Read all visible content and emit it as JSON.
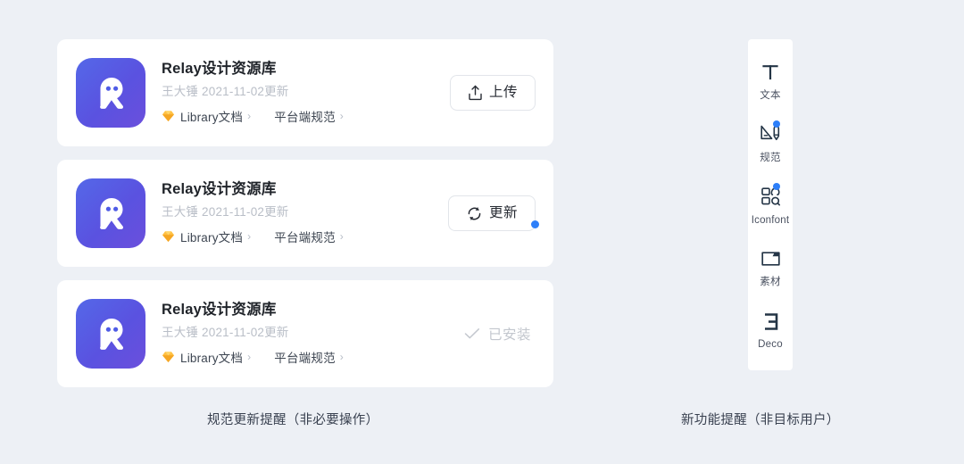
{
  "theme": {
    "page_background": "#EDF0F5",
    "card_background": "#FFFFFF",
    "accent_blue": "#2D7FF9",
    "icon_gradient_start": "#5468E8",
    "icon_gradient_end": "#6B4FDC",
    "sketch_icon_color": "#F7B500",
    "muted_text": "#B9BEC7",
    "toolbar_icon_color": "#243546"
  },
  "cards": [
    {
      "icon_name": "relay-app-icon",
      "title": "Relay设计资源库",
      "subtitle": "王大锤 2021-11-02更新",
      "tags": [
        {
          "icon": "sketch-diamond-icon",
          "label": "Library文档",
          "chevron": "›"
        },
        {
          "icon": null,
          "label": "平台端规范",
          "chevron": "›"
        }
      ],
      "action": {
        "type": "button",
        "name": "upload-button",
        "icon": "upload-icon",
        "label": "上传",
        "badge": false
      }
    },
    {
      "icon_name": "relay-app-icon",
      "title": "Relay设计资源库",
      "subtitle": "王大锤 2021-11-02更新",
      "tags": [
        {
          "icon": "sketch-diamond-icon",
          "label": "Library文档",
          "chevron": "›"
        },
        {
          "icon": null,
          "label": "平台端规范",
          "chevron": "›"
        }
      ],
      "action": {
        "type": "button",
        "name": "update-button",
        "icon": "refresh-icon",
        "label": "更新",
        "badge": true
      }
    },
    {
      "icon_name": "relay-app-icon",
      "title": "Relay设计资源库",
      "subtitle": "王大锤 2021-11-02更新",
      "tags": [
        {
          "icon": "sketch-diamond-icon",
          "label": "Library文档",
          "chevron": "›"
        },
        {
          "icon": null,
          "label": "平台端规范",
          "chevron": "›"
        }
      ],
      "action": {
        "type": "status",
        "name": "installed-status",
        "icon": "check-icon",
        "label": "已安装",
        "badge": false
      }
    }
  ],
  "toolbar": {
    "items": [
      {
        "icon": "text-tool-icon",
        "label": "文本",
        "badge": false
      },
      {
        "icon": "spec-ruler-pen-icon",
        "label": "规范",
        "badge": true
      },
      {
        "icon": "iconfont-grid-icon",
        "label": "Iconfont",
        "badge": true
      },
      {
        "icon": "folder-icon",
        "label": "素材",
        "badge": false
      },
      {
        "icon": "deco-icon",
        "label": "Deco",
        "badge": false
      }
    ]
  },
  "captions": {
    "left": "规范更新提醒（非必要操作）",
    "right": "新功能提醒（非目标用户）"
  }
}
